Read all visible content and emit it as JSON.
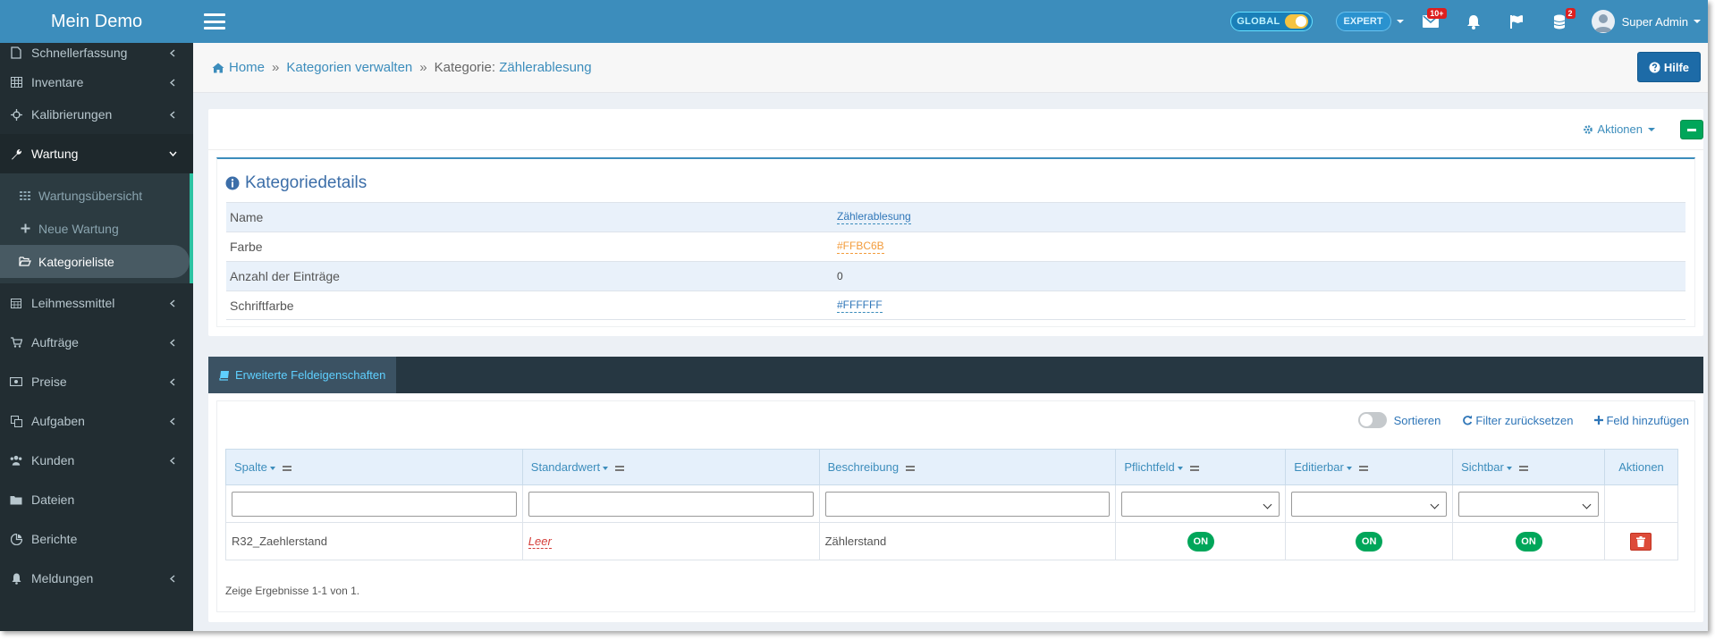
{
  "brand": {
    "title": "Mein Demo"
  },
  "topbar": {
    "global_label": "GLOBAL",
    "expert_label": "EXPERT",
    "mail_badge": "10+",
    "tasks_badge": "2",
    "user_name": "Super Admin"
  },
  "sidebar": {
    "items": [
      {
        "label": "Schnellerfassung",
        "icon": "file-icon"
      },
      {
        "label": "Inventare",
        "icon": "table-icon"
      },
      {
        "label": "Kalibrierungen",
        "icon": "crosshair-icon"
      },
      {
        "label": "Wartung",
        "icon": "wrench-icon"
      }
    ],
    "sub_items": [
      {
        "label": "Wartungsübersicht",
        "icon": "grid-icon"
      },
      {
        "label": "Neue Wartung",
        "icon": "plus-icon"
      },
      {
        "label": "Kategorieliste",
        "icon": "folder-open-icon"
      }
    ],
    "items_after": [
      {
        "label": "Leihmessmittel",
        "icon": "calendar-icon"
      },
      {
        "label": "Aufträge",
        "icon": "cart-icon"
      },
      {
        "label": "Preise",
        "icon": "money-icon"
      },
      {
        "label": "Aufgaben",
        "icon": "copy-icon"
      },
      {
        "label": "Kunden",
        "icon": "users-icon"
      },
      {
        "label": "Dateien",
        "icon": "folder-icon"
      },
      {
        "label": "Berichte",
        "icon": "pie-icon"
      },
      {
        "label": "Meldungen",
        "icon": "bell-icon"
      }
    ]
  },
  "breadcrumb": {
    "home": "Home",
    "level1": "Kategorien verwalten",
    "level2_prefix": "Kategorie:",
    "level2_value": "Zählerablesung",
    "help_button": "Hilfe"
  },
  "details": {
    "actions_label": "Aktionen",
    "title": "Kategoriedetails",
    "rows": [
      {
        "key": "Name",
        "value": "Zählerablesung"
      },
      {
        "key": "Farbe",
        "value": "#FFBC6B"
      },
      {
        "key": "Anzahl der Einträge",
        "value": "0"
      },
      {
        "key": "Schriftfarbe",
        "value": "#FFFFFF"
      }
    ]
  },
  "fields": {
    "tab_label": "Erweiterte Feldeigenschaften",
    "toolbar": {
      "sort_label": "Sortieren",
      "reset_label": "Filter zurücksetzen",
      "add_label": "Feld hinzufügen"
    },
    "columns": [
      "Spalte",
      "Standardwert",
      "Beschreibung",
      "Pflichtfeld",
      "Editierbar",
      "Sichtbar",
      "Aktionen"
    ],
    "rows": [
      {
        "spalte": "R32_Zaehlerstand",
        "standardwert": "Leer",
        "beschreibung": "Zählerstand",
        "pflichtfeld": "ON",
        "editierbar": "ON",
        "sichtbar": "ON"
      }
    ],
    "summary": "Zeige Ergebnisse 1-1 von 1."
  },
  "colors": {
    "accent": "#3c8dbc",
    "sidebar": "#222d32",
    "success": "#00a65a",
    "danger": "#dd4b39",
    "category_color": "#FFBC6B"
  }
}
